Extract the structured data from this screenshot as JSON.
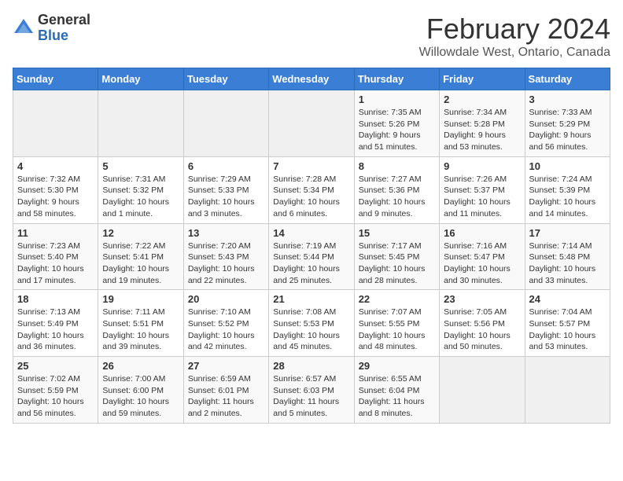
{
  "header": {
    "logo_general": "General",
    "logo_blue": "Blue",
    "main_title": "February 2024",
    "subtitle": "Willowdale West, Ontario, Canada"
  },
  "calendar": {
    "days_of_week": [
      "Sunday",
      "Monday",
      "Tuesday",
      "Wednesday",
      "Thursday",
      "Friday",
      "Saturday"
    ],
    "weeks": [
      [
        {
          "day": "",
          "info": ""
        },
        {
          "day": "",
          "info": ""
        },
        {
          "day": "",
          "info": ""
        },
        {
          "day": "",
          "info": ""
        },
        {
          "day": "1",
          "info": "Sunrise: 7:35 AM\nSunset: 5:26 PM\nDaylight: 9 hours\nand 51 minutes."
        },
        {
          "day": "2",
          "info": "Sunrise: 7:34 AM\nSunset: 5:28 PM\nDaylight: 9 hours\nand 53 minutes."
        },
        {
          "day": "3",
          "info": "Sunrise: 7:33 AM\nSunset: 5:29 PM\nDaylight: 9 hours\nand 56 minutes."
        }
      ],
      [
        {
          "day": "4",
          "info": "Sunrise: 7:32 AM\nSunset: 5:30 PM\nDaylight: 9 hours\nand 58 minutes."
        },
        {
          "day": "5",
          "info": "Sunrise: 7:31 AM\nSunset: 5:32 PM\nDaylight: 10 hours\nand 1 minute."
        },
        {
          "day": "6",
          "info": "Sunrise: 7:29 AM\nSunset: 5:33 PM\nDaylight: 10 hours\nand 3 minutes."
        },
        {
          "day": "7",
          "info": "Sunrise: 7:28 AM\nSunset: 5:34 PM\nDaylight: 10 hours\nand 6 minutes."
        },
        {
          "day": "8",
          "info": "Sunrise: 7:27 AM\nSunset: 5:36 PM\nDaylight: 10 hours\nand 9 minutes."
        },
        {
          "day": "9",
          "info": "Sunrise: 7:26 AM\nSunset: 5:37 PM\nDaylight: 10 hours\nand 11 minutes."
        },
        {
          "day": "10",
          "info": "Sunrise: 7:24 AM\nSunset: 5:39 PM\nDaylight: 10 hours\nand 14 minutes."
        }
      ],
      [
        {
          "day": "11",
          "info": "Sunrise: 7:23 AM\nSunset: 5:40 PM\nDaylight: 10 hours\nand 17 minutes."
        },
        {
          "day": "12",
          "info": "Sunrise: 7:22 AM\nSunset: 5:41 PM\nDaylight: 10 hours\nand 19 minutes."
        },
        {
          "day": "13",
          "info": "Sunrise: 7:20 AM\nSunset: 5:43 PM\nDaylight: 10 hours\nand 22 minutes."
        },
        {
          "day": "14",
          "info": "Sunrise: 7:19 AM\nSunset: 5:44 PM\nDaylight: 10 hours\nand 25 minutes."
        },
        {
          "day": "15",
          "info": "Sunrise: 7:17 AM\nSunset: 5:45 PM\nDaylight: 10 hours\nand 28 minutes."
        },
        {
          "day": "16",
          "info": "Sunrise: 7:16 AM\nSunset: 5:47 PM\nDaylight: 10 hours\nand 30 minutes."
        },
        {
          "day": "17",
          "info": "Sunrise: 7:14 AM\nSunset: 5:48 PM\nDaylight: 10 hours\nand 33 minutes."
        }
      ],
      [
        {
          "day": "18",
          "info": "Sunrise: 7:13 AM\nSunset: 5:49 PM\nDaylight: 10 hours\nand 36 minutes."
        },
        {
          "day": "19",
          "info": "Sunrise: 7:11 AM\nSunset: 5:51 PM\nDaylight: 10 hours\nand 39 minutes."
        },
        {
          "day": "20",
          "info": "Sunrise: 7:10 AM\nSunset: 5:52 PM\nDaylight: 10 hours\nand 42 minutes."
        },
        {
          "day": "21",
          "info": "Sunrise: 7:08 AM\nSunset: 5:53 PM\nDaylight: 10 hours\nand 45 minutes."
        },
        {
          "day": "22",
          "info": "Sunrise: 7:07 AM\nSunset: 5:55 PM\nDaylight: 10 hours\nand 48 minutes."
        },
        {
          "day": "23",
          "info": "Sunrise: 7:05 AM\nSunset: 5:56 PM\nDaylight: 10 hours\nand 50 minutes."
        },
        {
          "day": "24",
          "info": "Sunrise: 7:04 AM\nSunset: 5:57 PM\nDaylight: 10 hours\nand 53 minutes."
        }
      ],
      [
        {
          "day": "25",
          "info": "Sunrise: 7:02 AM\nSunset: 5:59 PM\nDaylight: 10 hours\nand 56 minutes."
        },
        {
          "day": "26",
          "info": "Sunrise: 7:00 AM\nSunset: 6:00 PM\nDaylight: 10 hours\nand 59 minutes."
        },
        {
          "day": "27",
          "info": "Sunrise: 6:59 AM\nSunset: 6:01 PM\nDaylight: 11 hours\nand 2 minutes."
        },
        {
          "day": "28",
          "info": "Sunrise: 6:57 AM\nSunset: 6:03 PM\nDaylight: 11 hours\nand 5 minutes."
        },
        {
          "day": "29",
          "info": "Sunrise: 6:55 AM\nSunset: 6:04 PM\nDaylight: 11 hours\nand 8 minutes."
        },
        {
          "day": "",
          "info": ""
        },
        {
          "day": "",
          "info": ""
        }
      ]
    ]
  }
}
